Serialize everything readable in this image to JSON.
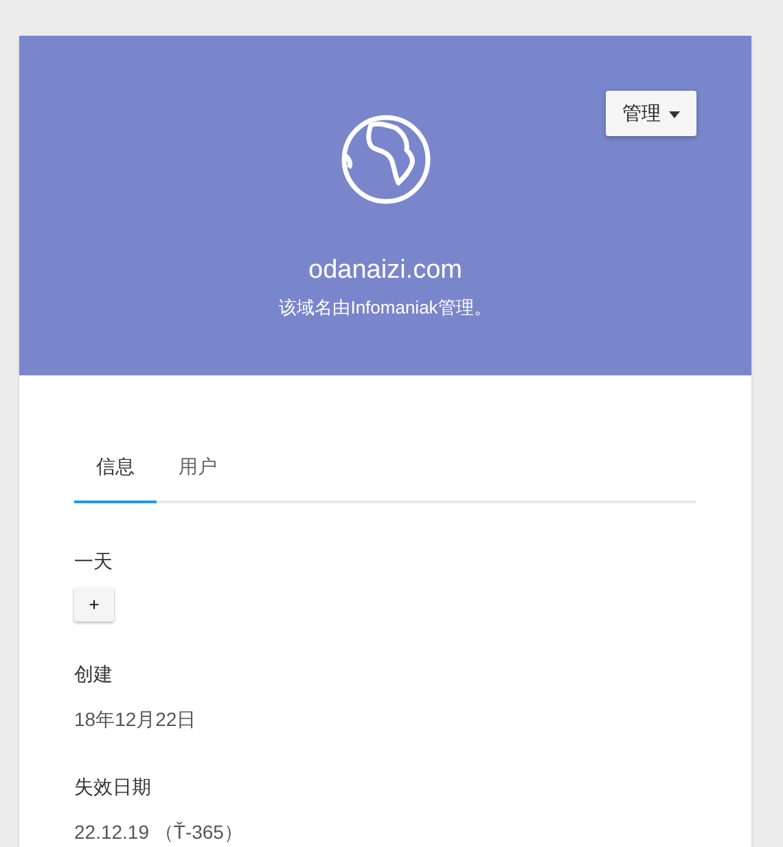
{
  "header": {
    "manage_button": "管理",
    "domain": "odanaizi.com",
    "subtitle": "该域名由Infomaniak管理。"
  },
  "tabs": [
    {
      "label": "信息",
      "selected": true
    },
    {
      "label": "用户",
      "selected": false
    }
  ],
  "fields": [
    {
      "kind": "button",
      "label": "一天",
      "value": "+"
    },
    {
      "kind": "text",
      "label": "创建",
      "value": "18年12月22日"
    },
    {
      "kind": "text",
      "label": "失效日期",
      "value": "22.12.19 （Ť-365）"
    }
  ]
}
